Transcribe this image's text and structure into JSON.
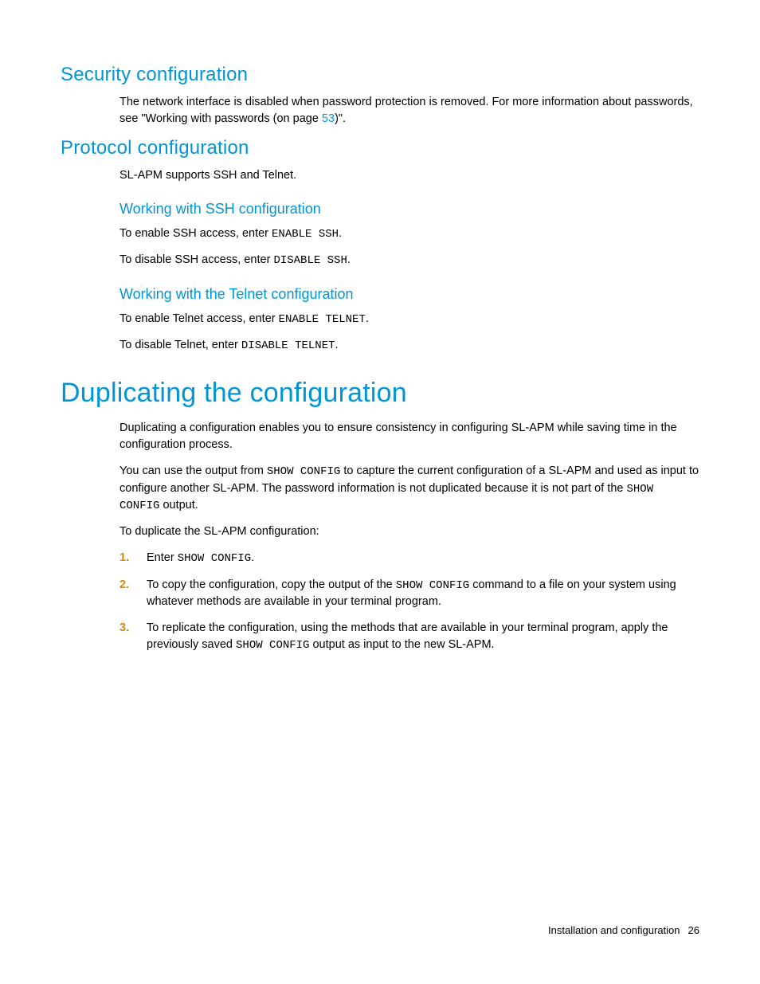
{
  "headings": {
    "security": "Security configuration",
    "protocol": "Protocol configuration",
    "ssh": "Working with SSH configuration",
    "telnet": "Working with the Telnet configuration",
    "duplicating": "Duplicating the configuration"
  },
  "security": {
    "para_a": "The network interface is disabled when password protection is removed. For more information about passwords, see \"Working with passwords (on page ",
    "link": "53",
    "para_b": ")\"."
  },
  "protocol": {
    "intro": "SL-APM supports SSH and Telnet."
  },
  "ssh": {
    "enable_a": "To enable SSH access, enter ",
    "enable_cmd": "ENABLE SSH",
    "enable_b": ".",
    "disable_a": "To disable SSH access, enter ",
    "disable_cmd": "DISABLE SSH",
    "disable_b": "."
  },
  "telnet": {
    "enable_a": "To enable Telnet access, enter ",
    "enable_cmd": "ENABLE TELNET",
    "enable_b": ".",
    "disable_a": "To disable Telnet, enter ",
    "disable_cmd": "DISABLE TELNET",
    "disable_b": "."
  },
  "dup": {
    "p1": "Duplicating a configuration enables you to ensure consistency in configuring SL-APM while saving time in the configuration process.",
    "p2a": "You can use the output from ",
    "p2cmd1": "SHOW CONFIG",
    "p2b": " to capture the current configuration of a SL-APM and used as input to configure another SL-APM. The password information is not duplicated because it is not part of the ",
    "p2cmd2": "SHOW CONFIG",
    "p2c": " output.",
    "p3": "To duplicate the SL-APM configuration:",
    "steps": {
      "n1": "1.",
      "n2": "2.",
      "n3": "3.",
      "s1a": "Enter ",
      "s1cmd": "SHOW CONFIG",
      "s1b": ".",
      "s2a": "To copy the configuration, copy the output of the ",
      "s2cmd": "SHOW CONFIG",
      "s2b": " command to a file on your system using whatever methods are available in your terminal program.",
      "s3a": "To replicate the configuration, using the methods that are available in your terminal program, apply the previously saved ",
      "s3cmd": "SHOW CONFIG",
      "s3b": " output as input to the new SL-APM."
    }
  },
  "footer": {
    "section": "Installation and configuration",
    "page": "26"
  }
}
